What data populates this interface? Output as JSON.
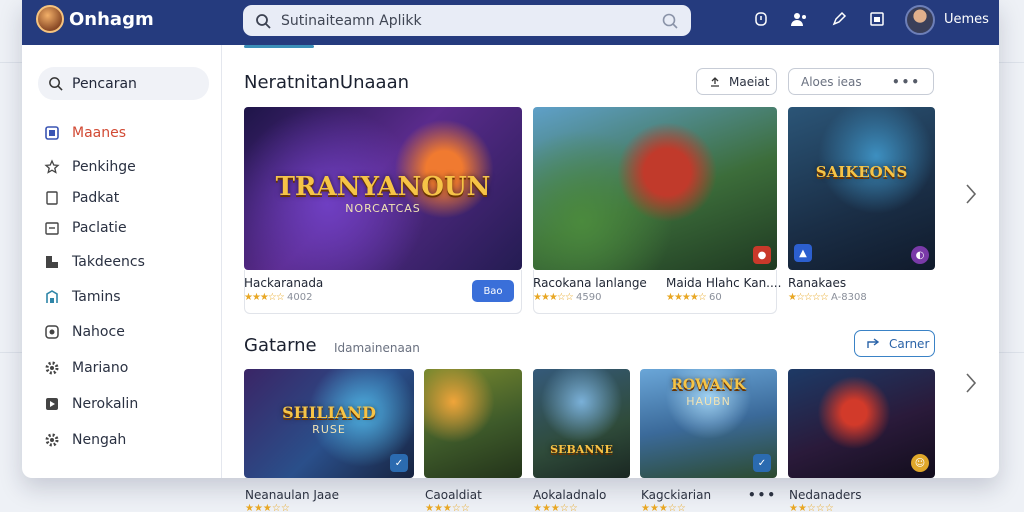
{
  "header": {
    "app_name": "Onhagm",
    "search_placeholder": "Sutinaiteamn Aplikk",
    "user_name": "Uemes"
  },
  "sidebar": {
    "search_label": "Pencaran",
    "items": [
      {
        "label": "Maanes",
        "icon": "gamepad-icon",
        "active": true
      },
      {
        "label": "Penkihge",
        "icon": "star-icon",
        "active": false
      },
      {
        "label": "Padkat",
        "icon": "document-icon",
        "active": false
      },
      {
        "label": "Paclatie",
        "icon": "calendar-icon",
        "active": false
      },
      {
        "label": "Takdeencs",
        "icon": "grid-icon",
        "active": false
      },
      {
        "label": "Tamins",
        "icon": "building-icon",
        "active": false
      },
      {
        "label": "Nahoce",
        "icon": "shield-icon",
        "active": false
      },
      {
        "label": "Mariano",
        "icon": "settings-icon",
        "active": false
      },
      {
        "label": "Nerokalin",
        "icon": "play-icon",
        "active": false
      },
      {
        "label": "Nengah",
        "icon": "gear-icon",
        "active": false
      }
    ]
  },
  "featured": {
    "title": "NeratnitanUnaaan",
    "button_label": "Maeiat",
    "filter_placeholder": "Aloes ieas",
    "cards": [
      {
        "art_title": "TRANYANOUN",
        "art_sub": "NORCATCAS",
        "name": "Hackaranada",
        "rating": "4002",
        "action": "Bao"
      },
      {
        "art_title": "",
        "art_sub": "",
        "name": "Racokana lanlange",
        "rating": "4590",
        "action": ""
      },
      {
        "art_title": "",
        "art_sub": "",
        "name": "Maida Hlahc Kan....",
        "rating": "60",
        "action": ""
      },
      {
        "art_title": "SAIKEONS",
        "art_sub": "",
        "name": "Ranakaes",
        "rating": "A-8308",
        "action": ""
      }
    ]
  },
  "games": {
    "title": "Gatarne",
    "subtitle": "Idamainenaan",
    "button_label": "Carner",
    "cards": [
      {
        "art_title": "SHILIAND",
        "art_sub": "RUSE",
        "name": "Neanaulan Jaae",
        "rating": ""
      },
      {
        "art_title": "",
        "art_sub": "",
        "name": "Caoaldiat",
        "rating": ""
      },
      {
        "art_title": "SEBANNE",
        "art_sub": "",
        "name": "Aokaladnalo",
        "rating": ""
      },
      {
        "art_title": "ROWANK",
        "art_sub": "HAUBN",
        "name": "Kagckiarian",
        "rating": ""
      },
      {
        "art_title": "",
        "art_sub": "",
        "name": "Nedanaders",
        "rating": ""
      }
    ]
  },
  "colors": {
    "header": "#253b7e",
    "accent": "#d24a34",
    "link": "#3a6fd9"
  }
}
